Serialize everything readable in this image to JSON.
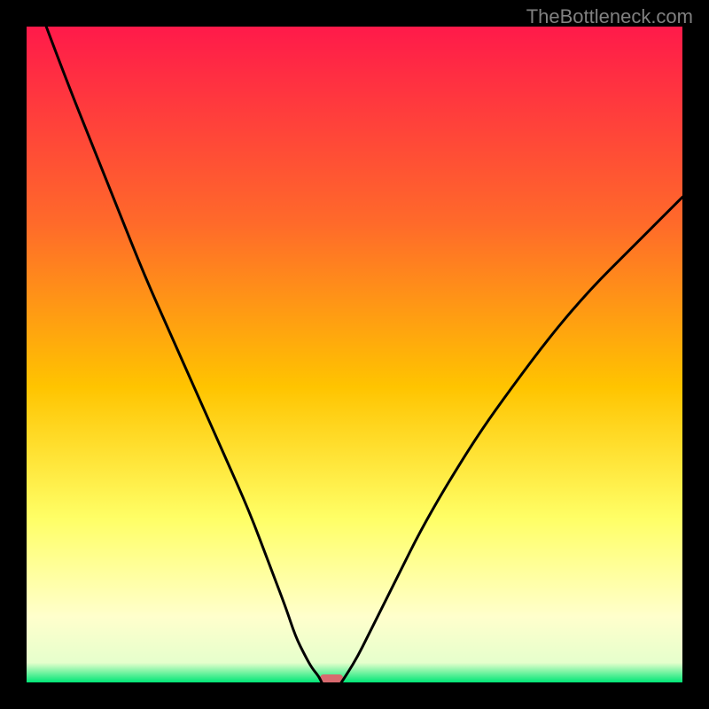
{
  "watermark": "TheBottleneck.com",
  "chart_data": {
    "type": "line",
    "title": "",
    "xlabel": "",
    "ylabel": "",
    "xlim": [
      0,
      100
    ],
    "ylim": [
      0,
      100
    ],
    "background_gradient": {
      "stops": [
        {
          "offset": 0,
          "color": "#ff1a4a"
        },
        {
          "offset": 30,
          "color": "#ff6a2a"
        },
        {
          "offset": 55,
          "color": "#ffc400"
        },
        {
          "offset": 75,
          "color": "#ffff66"
        },
        {
          "offset": 90,
          "color": "#ffffcc"
        },
        {
          "offset": 97,
          "color": "#e6ffcc"
        },
        {
          "offset": 100,
          "color": "#00e676"
        }
      ]
    },
    "series": [
      {
        "name": "left-curve",
        "x": [
          3,
          6,
          10,
          14,
          18,
          22,
          26,
          30,
          34,
          37,
          39.5,
          41,
          42.5,
          43.5,
          44.5,
          45
        ],
        "y": [
          100,
          92,
          82,
          72,
          62,
          53,
          44,
          35,
          26,
          18,
          11.5,
          7,
          4,
          2.2,
          1,
          0
        ]
      },
      {
        "name": "right-curve",
        "x": [
          48,
          49,
          50.5,
          52,
          54,
          57,
          60,
          64,
          69,
          74,
          80,
          86,
          92,
          98,
          100
        ],
        "y": [
          0,
          1.5,
          4,
          7,
          11,
          17,
          23,
          30,
          38,
          45,
          53,
          60,
          66,
          72,
          74
        ]
      }
    ],
    "marker": {
      "x_center": 46.5,
      "y": 0,
      "width": 3.5,
      "color": "#d86a6f"
    }
  }
}
